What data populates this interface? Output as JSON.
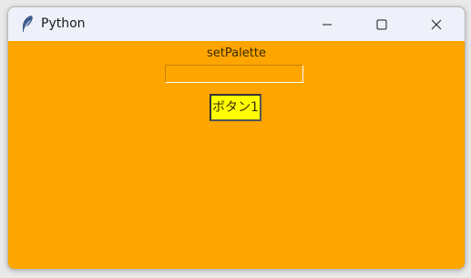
{
  "window": {
    "title": "Python",
    "background": "#ffa500",
    "titlebar_bg": "#eef1f9",
    "icon": "feather-icon"
  },
  "titlebar": {
    "controls": [
      {
        "name": "minimize",
        "icon": "minimize-icon"
      },
      {
        "name": "maximize",
        "icon": "maximize-icon"
      },
      {
        "name": "close",
        "icon": "close-icon"
      }
    ]
  },
  "content": {
    "label": "setPalette",
    "entry_value": "",
    "button_label": "ボタン1",
    "button_bg": "#ffff00"
  }
}
